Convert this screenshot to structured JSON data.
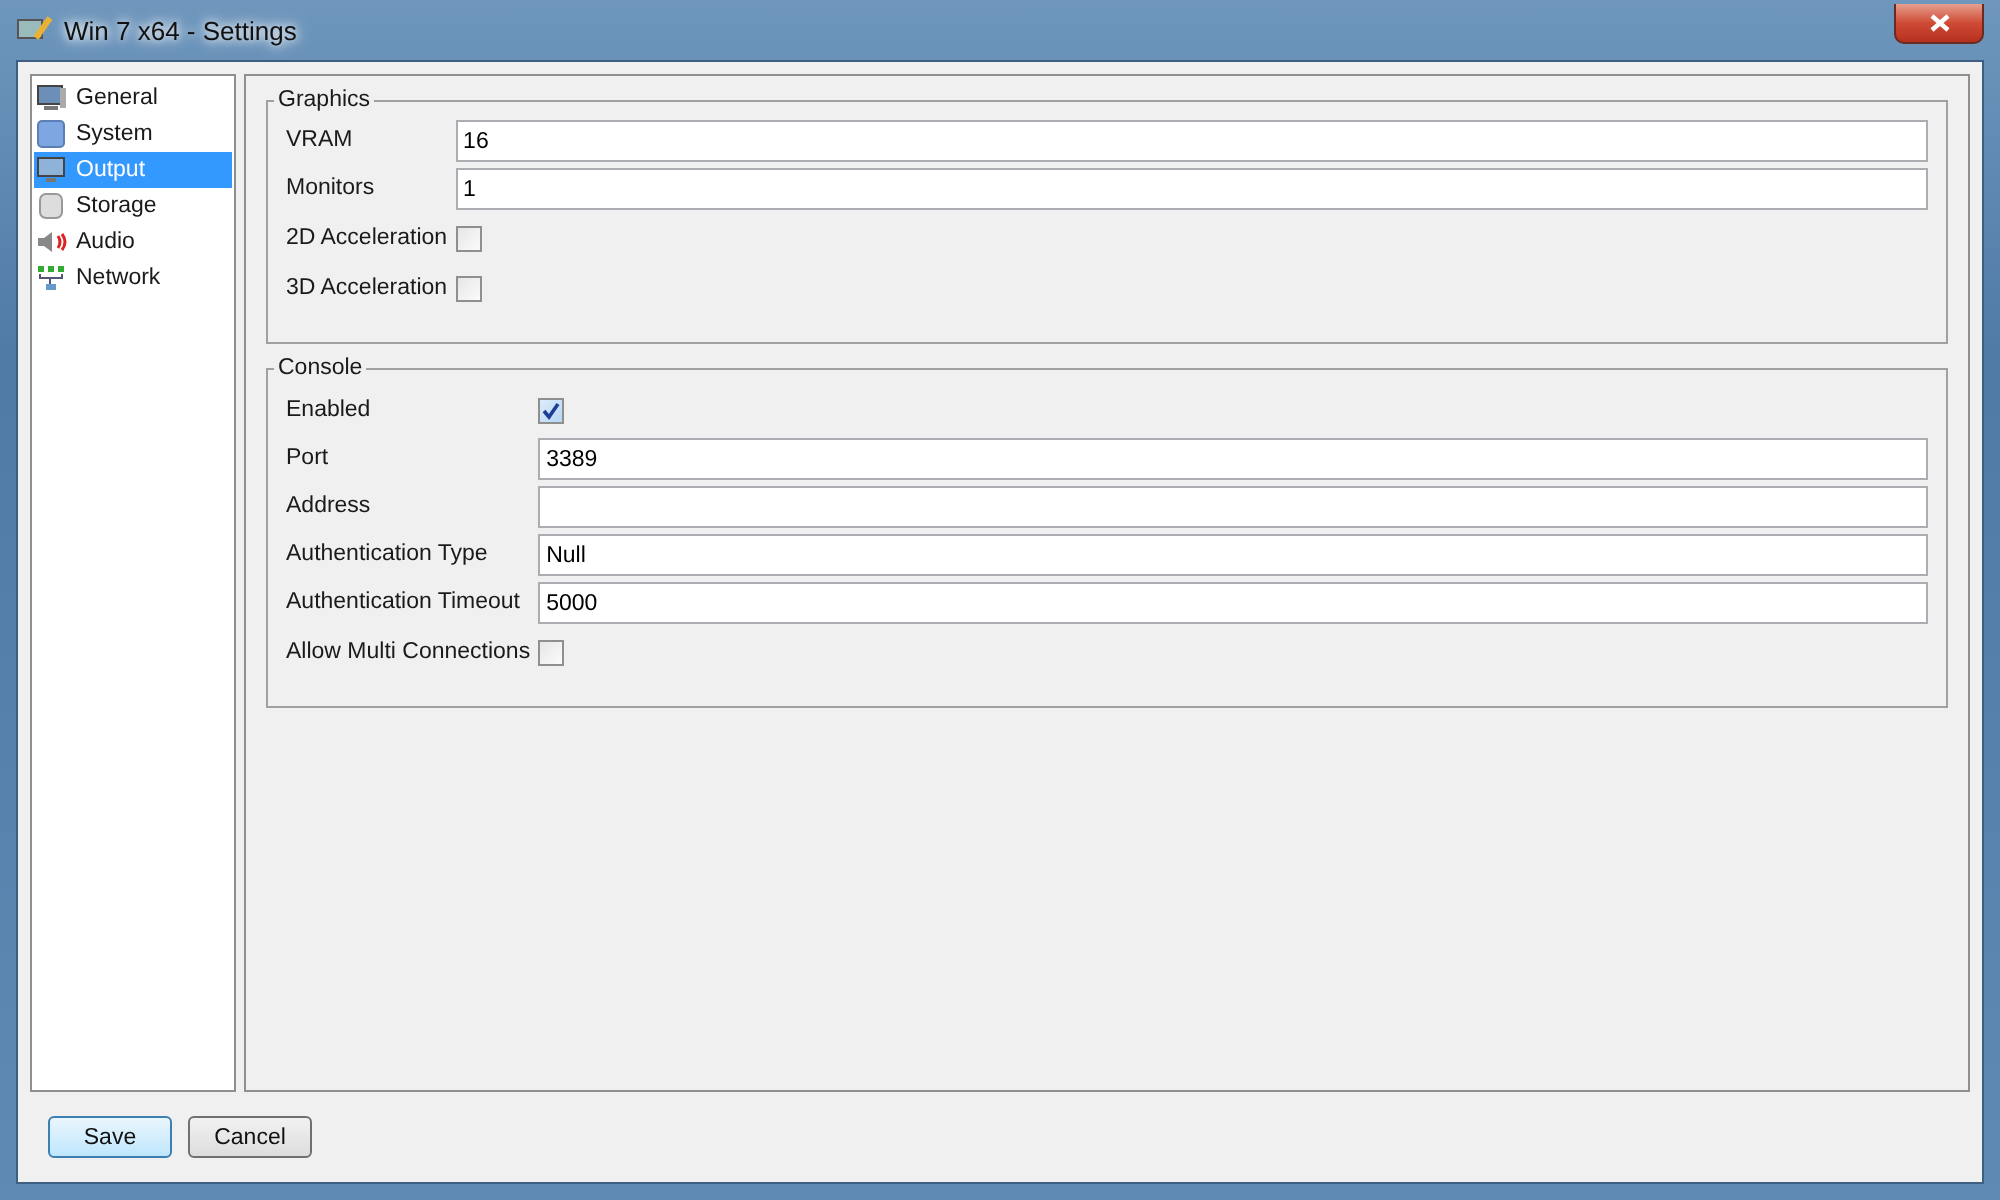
{
  "window": {
    "title": "Win 7 x64 - Settings"
  },
  "sidebar": {
    "items": [
      {
        "label": "General",
        "selected": false
      },
      {
        "label": "System",
        "selected": false
      },
      {
        "label": "Output",
        "selected": true
      },
      {
        "label": "Storage",
        "selected": false
      },
      {
        "label": "Audio",
        "selected": false
      },
      {
        "label": "Network",
        "selected": false
      }
    ]
  },
  "sections": [
    {
      "title": "Graphics",
      "fields": [
        {
          "kind": "text",
          "label": "VRAM",
          "value": "16"
        },
        {
          "kind": "text",
          "label": "Monitors",
          "value": "1"
        },
        {
          "kind": "checkbox",
          "label": "2D Acceleration",
          "checked": false
        },
        {
          "kind": "checkbox",
          "label": "3D Acceleration",
          "checked": false
        }
      ]
    },
    {
      "title": "Console",
      "fields": [
        {
          "kind": "checkbox",
          "label": "Enabled",
          "checked": true
        },
        {
          "kind": "text",
          "label": "Port",
          "value": "3389"
        },
        {
          "kind": "text",
          "label": "Address"
        },
        {
          "kind": "text",
          "label": "Authentication Type",
          "value": "Null"
        },
        {
          "kind": "text",
          "label": "Authentication Timeout",
          "value": "5000"
        },
        {
          "kind": "checkbox",
          "label": "Allow Multi Connections",
          "checked": false
        }
      ]
    }
  ],
  "buttons": [
    {
      "label": "Save",
      "selected": true
    },
    {
      "label": "Cancel",
      "selected": false
    }
  ]
}
